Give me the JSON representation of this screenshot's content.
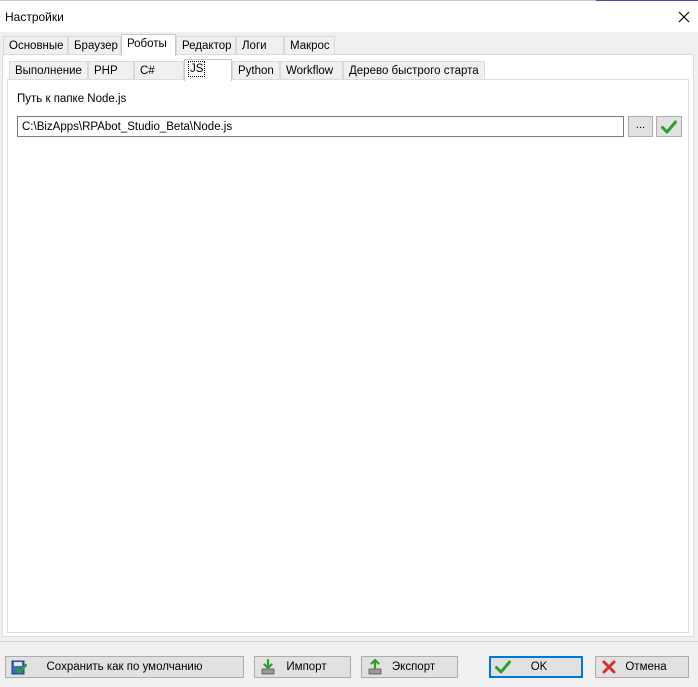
{
  "window": {
    "title": "Настройки"
  },
  "top_tabs": [
    {
      "label": "Основные",
      "active": false
    },
    {
      "label": "Браузер",
      "active": false
    },
    {
      "label": "Роботы",
      "active": true
    },
    {
      "label": "Редактор",
      "active": false
    },
    {
      "label": "Логи",
      "active": false
    },
    {
      "label": "Макрос",
      "active": false
    }
  ],
  "sub_tabs": [
    {
      "label": "Выполнение",
      "active": false
    },
    {
      "label": "PHP",
      "active": false
    },
    {
      "label": "C#",
      "active": false
    },
    {
      "label": "JS",
      "active": true
    },
    {
      "label": "Python",
      "active": false
    },
    {
      "label": "Workflow",
      "active": false
    },
    {
      "label": "Дерево быстрого старта",
      "active": false
    }
  ],
  "js_settings": {
    "path_label": "Путь к папке Node.js",
    "path_value": "C:\\BizApps\\RPAbot_Studio_Beta\\Node.js",
    "browse_label": "...",
    "apply_icon": "checkmark-icon"
  },
  "footer": {
    "save_default_label": "Сохранить как по умолчанию",
    "import_label": "Импорт",
    "export_label": "Экспорт",
    "ok_label": "OK",
    "cancel_label": "Отмена"
  },
  "colors": {
    "accent_purple": "#5b3fa3",
    "check_green": "#2e9e2e",
    "cancel_red": "#d0342c",
    "focus_blue": "#0078d7"
  }
}
